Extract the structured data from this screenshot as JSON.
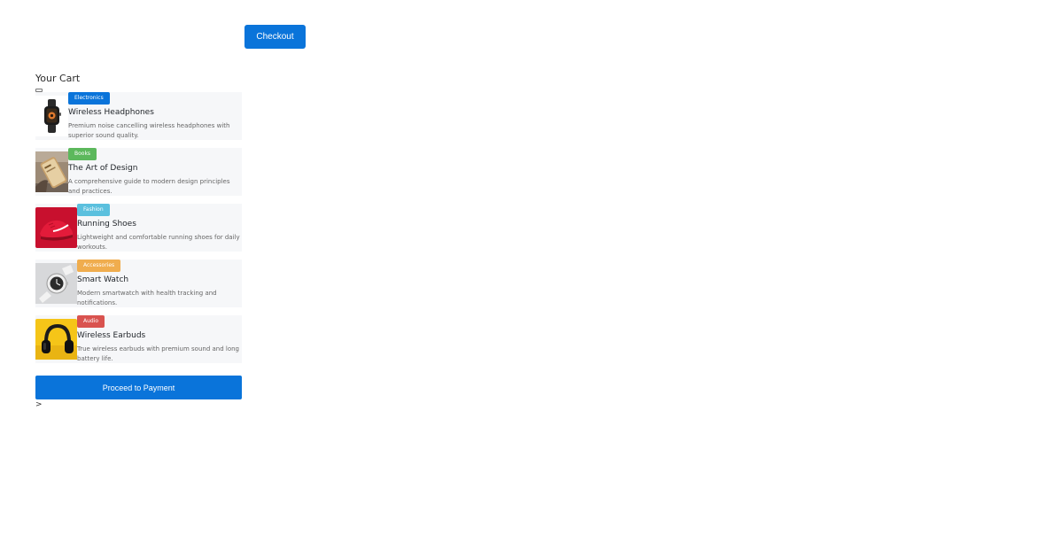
{
  "header": {
    "checkout_label": "Checkout"
  },
  "cart": {
    "title": "Your Cart",
    "items": [
      {
        "category": "Electronics",
        "category_color": "#0a74da",
        "name": "Wireless Headphones",
        "description": "Premium noise cancelling wireless headphones with superior sound quality.",
        "image_icon": "smartwatch-photo"
      },
      {
        "category": "Books",
        "category_color": "#5cb85c",
        "name": "The Art of Design",
        "description": "A comprehensive guide to modern design principles and practices.",
        "image_icon": "phone-on-table-photo"
      },
      {
        "category": "Fashion",
        "category_color": "#5bc0de",
        "name": "Running Shoes",
        "description": "Lightweight and comfortable running shoes for daily workouts.",
        "image_icon": "red-sneaker-photo"
      },
      {
        "category": "Accessories",
        "category_color": "#f0ad4e",
        "name": "Smart Watch",
        "description": "Modern smartwatch with health tracking and notifications.",
        "image_icon": "white-watch-photo"
      },
      {
        "category": "Audio",
        "category_color": "#d9534f",
        "name": "Wireless Earbuds",
        "description": "True wireless earbuds with premium sound and long battery life.",
        "image_icon": "headphones-photo"
      }
    ],
    "proceed_label": "Proceed to Payment",
    "footer_chevron": ">"
  }
}
